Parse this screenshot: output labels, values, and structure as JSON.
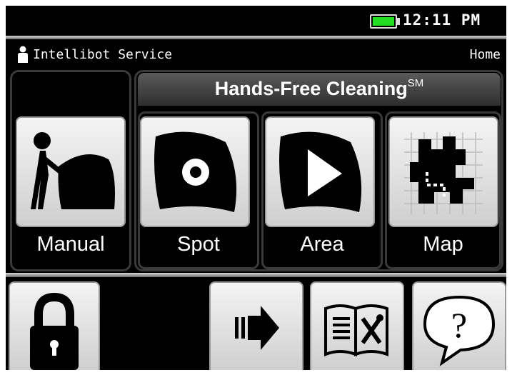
{
  "status_bar": {
    "time": "12:11 PM",
    "battery_color": "#22dd22"
  },
  "user_row": {
    "user_label": "Intellibot Service",
    "user_icon": "person-icon",
    "nav_label": "Home"
  },
  "hands_free": {
    "title": "Hands-Free Cleaning",
    "title_mark": "SM"
  },
  "modes": [
    {
      "label": "Manual",
      "icon": "operator-pushing-machine-icon"
    },
    {
      "label": "Spot",
      "icon": "spot-target-icon"
    },
    {
      "label": "Area",
      "icon": "area-play-icon"
    },
    {
      "label": "Map",
      "icon": "map-route-icon"
    }
  ],
  "bottom_buttons": [
    {
      "icon": "lock-icon"
    },
    {
      "icon": "forward-arrow-icon"
    },
    {
      "icon": "manual-tools-icon"
    },
    {
      "icon": "help-question-icon"
    }
  ]
}
